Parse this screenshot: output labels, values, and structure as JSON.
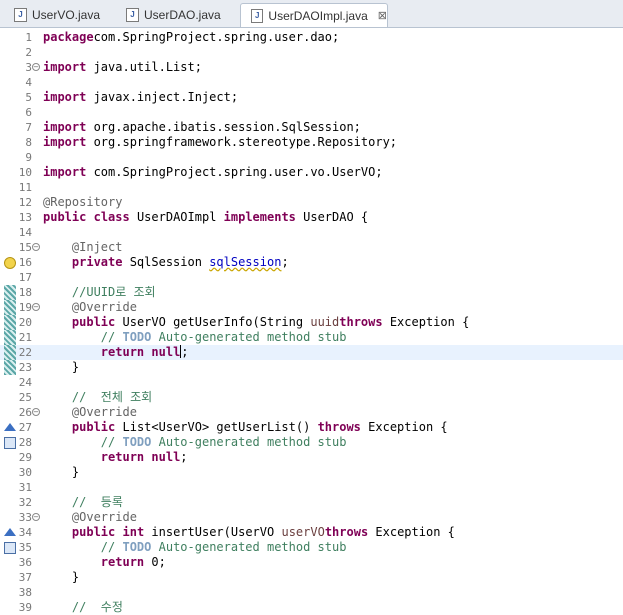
{
  "tabs": [
    {
      "label": "UserVO.java",
      "active": false
    },
    {
      "label": "UserDAO.java",
      "active": false
    },
    {
      "label": "UserDAOImpl.java",
      "active": true
    }
  ],
  "close_glyph": "⊠",
  "icon_letter": "J",
  "lines": [
    {
      "n": "1",
      "tokens": [
        [
          "kw",
          "package"
        ],
        [
          "",
          "com.SpringProject.spring.user.dao;"
        ]
      ]
    },
    {
      "n": "2",
      "tokens": []
    },
    {
      "n": "3",
      "fold": "−",
      "tokens": [
        [
          "kw",
          "import"
        ],
        [
          "",
          " java.util.List;"
        ]
      ]
    },
    {
      "n": "4",
      "tokens": []
    },
    {
      "n": "5",
      "tokens": [
        [
          "kw",
          "import"
        ],
        [
          "",
          " javax.inject.Inject;"
        ]
      ]
    },
    {
      "n": "6",
      "tokens": []
    },
    {
      "n": "7",
      "tokens": [
        [
          "kw",
          "import"
        ],
        [
          "",
          " org.apache.ibatis.session.SqlSession;"
        ]
      ]
    },
    {
      "n": "8",
      "tokens": [
        [
          "kw",
          "import"
        ],
        [
          "",
          " org.springframework.stereotype.Repository;"
        ]
      ]
    },
    {
      "n": "9",
      "tokens": []
    },
    {
      "n": "10",
      "tokens": [
        [
          "kw",
          "import"
        ],
        [
          "",
          " com.SpringProject.spring.user.vo.UserVO;"
        ]
      ]
    },
    {
      "n": "11",
      "tokens": []
    },
    {
      "n": "12",
      "tokens": [
        [
          "ann",
          "@Repository"
        ]
      ]
    },
    {
      "n": "13",
      "tokens": [
        [
          "kw",
          "public"
        ],
        [
          "",
          " "
        ],
        [
          "kw",
          "class"
        ],
        [
          "",
          " UserDAOImpl "
        ],
        [
          "kw",
          "implements"
        ],
        [
          "",
          " UserDAO {"
        ]
      ]
    },
    {
      "n": "14",
      "tokens": []
    },
    {
      "n": "15",
      "fold": "−",
      "tokens": [
        [
          "",
          "    "
        ],
        [
          "ann",
          "@Inject"
        ]
      ]
    },
    {
      "n": "16",
      "marker": "bulb",
      "tokens": [
        [
          "",
          "    "
        ],
        [
          "kw",
          "private"
        ],
        [
          "",
          " SqlSession "
        ],
        [
          "fld warn",
          "sqlSession"
        ],
        [
          "",
          ";"
        ]
      ]
    },
    {
      "n": "17",
      "tokens": []
    },
    {
      "n": "18",
      "marker": "hatch",
      "tokens": [
        [
          "",
          "    "
        ],
        [
          "cm",
          "//UUID로 조회"
        ]
      ]
    },
    {
      "n": "19",
      "marker": "hatch",
      "fold": "−",
      "tokens": [
        [
          "",
          "    "
        ],
        [
          "ann",
          "@Override"
        ]
      ]
    },
    {
      "n": "20",
      "marker": "hatch",
      "tokens": [
        [
          "",
          "    "
        ],
        [
          "kw",
          "public"
        ],
        [
          "",
          " UserVO getUserInfo(String "
        ],
        [
          "prm",
          "uuid"
        ],
        [
          ") "
        ],
        [
          "kw",
          "throws"
        ],
        [
          "",
          " Exception {"
        ]
      ]
    },
    {
      "n": "21",
      "marker": "hatch",
      "tokens": [
        [
          "",
          "        "
        ],
        [
          "cm",
          "// "
        ],
        [
          "todo",
          "TODO"
        ],
        [
          "cm",
          " Auto-generated method stub"
        ]
      ]
    },
    {
      "n": "22",
      "marker": "hatch",
      "current": true,
      "caret_after": true,
      "tokens": [
        [
          "",
          "        "
        ],
        [
          "kw",
          "return"
        ],
        [
          "",
          " "
        ],
        [
          "kw",
          "null"
        ],
        [
          "",
          ";"
        ]
      ]
    },
    {
      "n": "23",
      "marker": "hatch",
      "tokens": [
        [
          "",
          "    }"
        ]
      ]
    },
    {
      "n": "24",
      "tokens": []
    },
    {
      "n": "25",
      "tokens": [
        [
          "",
          "    "
        ],
        [
          "cm",
          "//  전체 조회"
        ]
      ]
    },
    {
      "n": "26",
      "fold": "−",
      "tokens": [
        [
          "",
          "    "
        ],
        [
          "ann",
          "@Override"
        ]
      ]
    },
    {
      "n": "27",
      "marker": "ovr",
      "tokens": [
        [
          "",
          "    "
        ],
        [
          "kw",
          "public"
        ],
        [
          "",
          " List<UserVO> getUserList() "
        ],
        [
          "kw",
          "throws"
        ],
        [
          "",
          " Exception {"
        ]
      ]
    },
    {
      "n": "28",
      "marker": "impl",
      "tokens": [
        [
          "",
          "        "
        ],
        [
          "cm",
          "// "
        ],
        [
          "todo",
          "TODO"
        ],
        [
          "cm",
          " Auto-generated method stub"
        ]
      ]
    },
    {
      "n": "29",
      "tokens": [
        [
          "",
          "        "
        ],
        [
          "kw",
          "return"
        ],
        [
          "",
          " "
        ],
        [
          "kw",
          "null"
        ],
        [
          "",
          ";"
        ]
      ]
    },
    {
      "n": "30",
      "tokens": [
        [
          "",
          "    }"
        ]
      ]
    },
    {
      "n": "31",
      "tokens": []
    },
    {
      "n": "32",
      "tokens": [
        [
          "",
          "    "
        ],
        [
          "cm",
          "//  등록"
        ]
      ]
    },
    {
      "n": "33",
      "fold": "−",
      "tokens": [
        [
          "",
          "    "
        ],
        [
          "ann",
          "@Override"
        ]
      ]
    },
    {
      "n": "34",
      "marker": "ovr",
      "tokens": [
        [
          "",
          "    "
        ],
        [
          "kw",
          "public"
        ],
        [
          "",
          " "
        ],
        [
          "kw",
          "int"
        ],
        [
          "",
          " insertUser(UserVO "
        ],
        [
          "prm",
          "userVO"
        ],
        [
          ") "
        ],
        [
          "kw",
          "throws"
        ],
        [
          "",
          " Exception {"
        ]
      ]
    },
    {
      "n": "35",
      "marker": "impl",
      "tokens": [
        [
          "",
          "        "
        ],
        [
          "cm",
          "// "
        ],
        [
          "todo",
          "TODO"
        ],
        [
          "cm",
          " Auto-generated method stub"
        ]
      ]
    },
    {
      "n": "36",
      "tokens": [
        [
          "",
          "        "
        ],
        [
          "kw",
          "return"
        ],
        [
          "",
          " 0;"
        ]
      ]
    },
    {
      "n": "37",
      "tokens": [
        [
          "",
          "    }"
        ]
      ]
    },
    {
      "n": "38",
      "tokens": []
    },
    {
      "n": "39",
      "tokens": [
        [
          "",
          "    "
        ],
        [
          "cm",
          "//  수정"
        ]
      ]
    }
  ],
  "colors": {
    "keyword": "#7f0055",
    "annotation": "#646464",
    "comment": "#3f7f5f",
    "todo": "#7f9fbf",
    "field": "#0000c0",
    "current_line": "#e8f2fe"
  }
}
